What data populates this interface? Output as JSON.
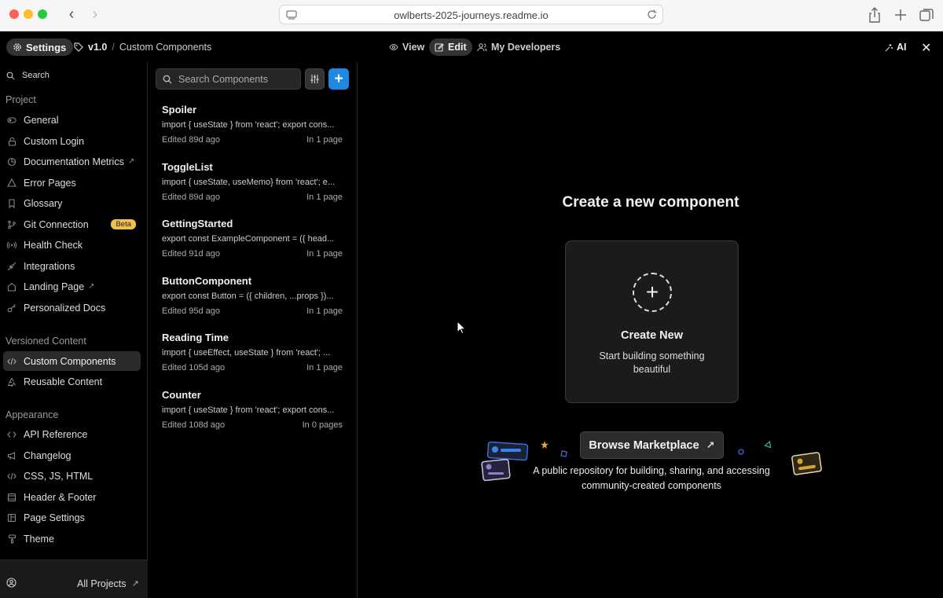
{
  "browser": {
    "url": "owlberts-2025-journeys.readme.io"
  },
  "topbar": {
    "settings_label": "Settings",
    "version": "v1.0",
    "separator": "/",
    "breadcrumb_page": "Custom Components",
    "view_label": "View",
    "edit_label": "Edit",
    "developers_label": "My Developers",
    "ai_label": "AI"
  },
  "sidebar": {
    "search_label": "Search",
    "sections": {
      "project": "Project",
      "versioned": "Versioned Content",
      "appearance": "Appearance"
    },
    "project_items": [
      {
        "label": "General"
      },
      {
        "label": "Custom Login"
      },
      {
        "label": "Documentation Metrics"
      },
      {
        "label": "Error Pages"
      },
      {
        "label": "Glossary"
      },
      {
        "label": "Git Connection",
        "badge": "Beta"
      },
      {
        "label": "Health Check"
      },
      {
        "label": "Integrations"
      },
      {
        "label": "Landing Page"
      },
      {
        "label": "Personalized Docs"
      }
    ],
    "versioned_items": [
      {
        "label": "Custom Components"
      },
      {
        "label": "Reusable Content"
      }
    ],
    "appearance_items": [
      {
        "label": "API Reference"
      },
      {
        "label": "Changelog"
      },
      {
        "label": "CSS, JS, HTML"
      },
      {
        "label": "Header & Footer"
      },
      {
        "label": "Page Settings"
      },
      {
        "label": "Theme"
      }
    ],
    "footer_label": "All Projects"
  },
  "components": {
    "search_placeholder": "Search Components",
    "items": [
      {
        "name": "Spoiler",
        "code": "import { useState } from 'react'; export cons...",
        "edited": "Edited 89d ago",
        "pages": "In 1 page"
      },
      {
        "name": "ToggleList",
        "code": "import { useState, useMemo} from 'react'; e...",
        "edited": "Edited 89d ago",
        "pages": "In 1 page"
      },
      {
        "name": "GettingStarted",
        "code": "export const ExampleComponent = ({ head...",
        "edited": "Edited 91d ago",
        "pages": "In 1 page"
      },
      {
        "name": "ButtonComponent",
        "code": "export const Button = ({ children, ...props })...",
        "edited": "Edited 95d ago",
        "pages": "In 1 page"
      },
      {
        "name": "Reading Time",
        "code": "import { useEffect, useState } from 'react'; ...",
        "edited": "Edited 105d ago",
        "pages": "In 1 page"
      },
      {
        "name": "Counter",
        "code": "import { useState } from 'react'; export cons...",
        "edited": "Edited 108d ago",
        "pages": "In 0 pages"
      }
    ]
  },
  "main": {
    "title": "Create a new component",
    "card_title": "Create New",
    "card_subtitle": "Start building something beautiful",
    "marketplace_label": "Browse Marketplace",
    "marketplace_desc": "A public repository for building, sharing, and accessing community-created components"
  },
  "colors": {
    "accent_blue": "#1e88e5",
    "beta_badge": "#f1c04a",
    "active_bg": "#2b2b2b"
  }
}
